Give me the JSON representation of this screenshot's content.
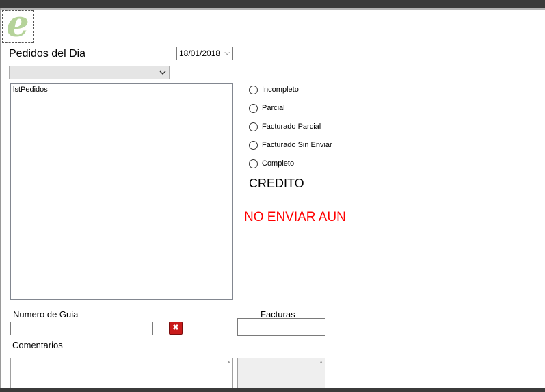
{
  "logo": {
    "letter": "e"
  },
  "header": {
    "title": "Pedidos del Dia",
    "date_value": "18/01/2018"
  },
  "filter_combo": {
    "value": ""
  },
  "orders_list": {
    "items": [
      "lstPedidos"
    ]
  },
  "status_options": [
    {
      "label": "Incompleto"
    },
    {
      "label": "Parcial"
    },
    {
      "label": "Facturado Parcial"
    },
    {
      "label": "Facturado Sin Enviar"
    },
    {
      "label": "Completo"
    }
  ],
  "labels": {
    "credito": "CREDITO",
    "no_enviar": "NO ENVIAR AUN",
    "numero_guia": "Numero de Guia",
    "facturas": "Facturas",
    "comentarios": "Comentarios"
  },
  "fields": {
    "numero_guia_value": "",
    "facturas_value": "",
    "comentarios_value": ""
  },
  "colors": {
    "alert_red": "#ff0000",
    "logo_green": "#b5d39a",
    "delete_red": "#c91b1b"
  },
  "icons": {
    "delete": "close-icon",
    "dropdown": "chevron-down-icon"
  }
}
